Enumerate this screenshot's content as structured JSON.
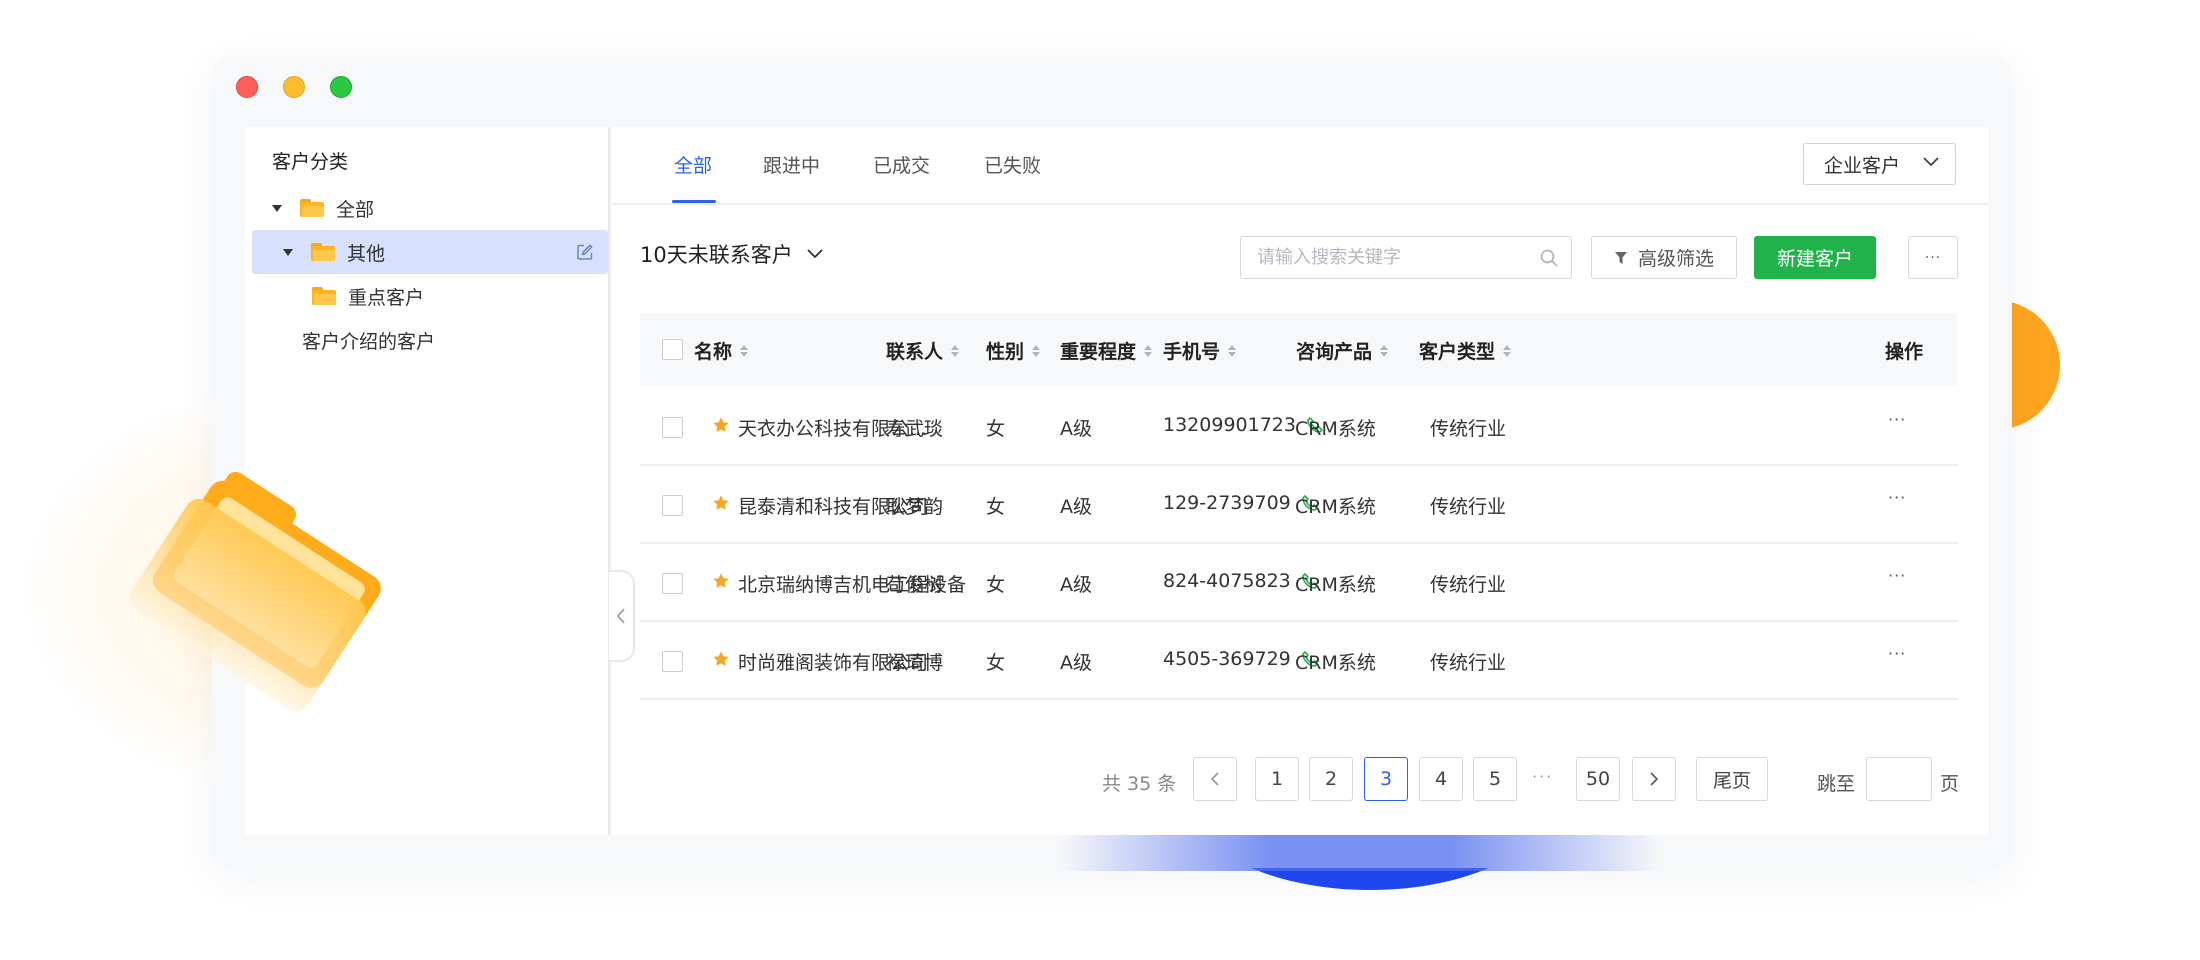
{
  "colors": {
    "accent_blue": "#2a63f0",
    "primary_green": "#21b24a",
    "star_orange": "#f5a623",
    "phone_green": "#21b24a",
    "selected_row_bg": "#d7e1fd"
  },
  "sidebar": {
    "title": "客户分类",
    "items": [
      {
        "label": "全部",
        "icon": "folder-icon",
        "expanded": true
      },
      {
        "label": "其他",
        "icon": "folder-icon",
        "expanded": true,
        "selected": true,
        "action_icon": "edit-icon"
      },
      {
        "label": "重点客户",
        "icon": "folder-icon"
      },
      {
        "label": "客户介绍的客户"
      }
    ]
  },
  "tabs": [
    "全部",
    "跟进中",
    "已成交",
    "已失败"
  ],
  "active_tab": "全部",
  "customer_type_select": "企业客户",
  "view_select": "10天未联系客户",
  "search": {
    "placeholder": "请输入搜索关键字",
    "icon": "search-icon"
  },
  "toolbar": {
    "filter_label": "高级筛选",
    "new_label": "新建客户",
    "more_label": "···"
  },
  "table": {
    "columns": [
      "名称",
      "联系人",
      "性别",
      "重要程度",
      "手机号",
      "咨询产品",
      "客户类型",
      "操作"
    ],
    "rows": [
      {
        "name": "天衣办公科技有限公...",
        "contact": "寿武琰",
        "gender": "女",
        "level": "A级",
        "phone": "13209901723",
        "product": "CRM系统",
        "type": "传统行业",
        "action": "···"
      },
      {
        "name": "昆泰清和科技有限公司",
        "contact": "耿梦韵",
        "gender": "女",
        "level": "A级",
        "phone": "129-2739709",
        "product": "CRM系统",
        "type": "传统行业",
        "action": "···"
      },
      {
        "name": "北京瑞纳博吉机电工程设备",
        "contact": "苟俊树",
        "gender": "女",
        "level": "A级",
        "phone": "824-4075823",
        "product": "CRM系统",
        "type": "传统行业",
        "action": "···"
      },
      {
        "name": "时尚雅阁装饰有限公司",
        "contact": "禄琦博",
        "gender": "女",
        "level": "A级",
        "phone": "4505-369729",
        "product": "CRM系统",
        "type": "传统行业",
        "action": "···"
      }
    ]
  },
  "pagination": {
    "total_text": "共 35 条",
    "prev": "<",
    "pages": [
      "1",
      "2",
      "3",
      "4",
      "5"
    ],
    "current_page": "3",
    "ellipsis": "···",
    "last_number": "50",
    "next": ">",
    "last_page_label": "尾页",
    "jump_label": "跳至",
    "jump_value": "",
    "page_suffix": "页"
  }
}
